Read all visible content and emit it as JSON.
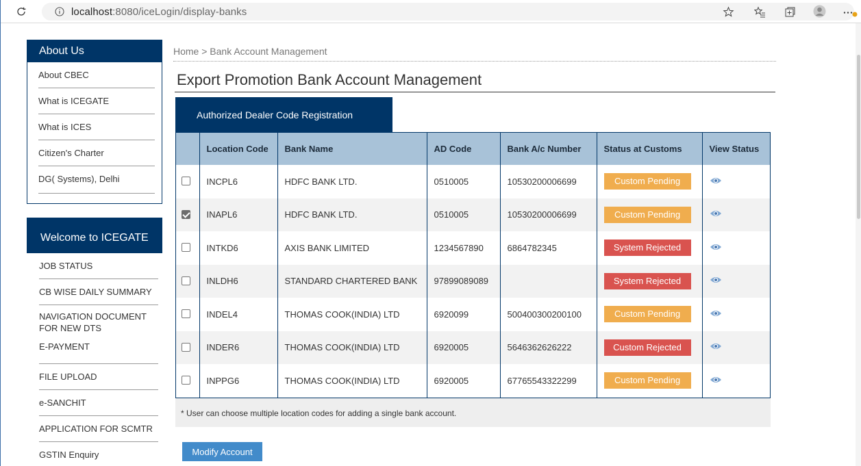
{
  "browser": {
    "url_host": "localhost",
    "url_path": ":8080/iceLogin/display-banks"
  },
  "breadcrumb": "Home > Bank Account Management",
  "page_title": "Export Promotion Bank Account Management",
  "tab_label": "Authorized Dealer Code Registration",
  "sidebar": {
    "about_header": "About Us",
    "about_items": [
      "About CBEC",
      "What is ICEGATE",
      "What is ICES",
      "Citizen's Charter",
      "DG( Systems), Delhi"
    ],
    "welcome_header": "Welcome to ICEGATE",
    "welcome_items": [
      "JOB STATUS",
      "CB WISE DAILY SUMMARY",
      "NAVIGATION DOCUMENT FOR NEW DTS",
      "E-PAYMENT",
      "FILE UPLOAD",
      "e-SANCHIT",
      "APPLICATION FOR SCMTR",
      "GSTIN Enquiry"
    ]
  },
  "table": {
    "headers": [
      "Location Code",
      "Bank Name",
      "AD Code",
      "Bank A/c Number",
      "Status at Customs",
      "View Status"
    ],
    "rows": [
      {
        "checked": false,
        "location_code": "INCPL6",
        "bank_name": "HDFC BANK LTD.",
        "ad_code": "0510005",
        "account_number": "10530200006699",
        "status": "Custom Pending",
        "status_type": "pending"
      },
      {
        "checked": true,
        "location_code": "INAPL6",
        "bank_name": "HDFC BANK LTD.",
        "ad_code": "0510005",
        "account_number": "10530200006699",
        "status": "Custom Pending",
        "status_type": "pending"
      },
      {
        "checked": false,
        "location_code": "INTKD6",
        "bank_name": "AXIS BANK LIMITED",
        "ad_code": "1234567890",
        "account_number": "6864782345",
        "status": "System Rejected",
        "status_type": "rejected"
      },
      {
        "checked": false,
        "location_code": "INLDH6",
        "bank_name": "STANDARD CHARTERED BANK",
        "ad_code": "97899089089",
        "account_number": "",
        "status": "System Rejected",
        "status_type": "rejected"
      },
      {
        "checked": false,
        "location_code": "INDEL4",
        "bank_name": "THOMAS COOK(INDIA) LTD",
        "ad_code": "6920099",
        "account_number": "500400300200100",
        "status": "Custom Pending",
        "status_type": "pending"
      },
      {
        "checked": false,
        "location_code": "INDER6",
        "bank_name": "THOMAS COOK(INDIA) LTD",
        "ad_code": "6920005",
        "account_number": "5646362626222",
        "status": "Custom Rejected",
        "status_type": "rejected"
      },
      {
        "checked": false,
        "location_code": "INPPG6",
        "bank_name": "THOMAS COOK(INDIA) LTD",
        "ad_code": "6920005",
        "account_number": "67765543322299",
        "status": "Custom Pending",
        "status_type": "pending"
      }
    ]
  },
  "note": "* User can choose multiple location codes for adding a single bank account.",
  "modify_button": "Modify Account",
  "colors": {
    "primary": "#003567",
    "header_bg": "#a8c2d8",
    "pending": "#f0ad4e",
    "rejected": "#d9534f",
    "button": "#428bca"
  }
}
